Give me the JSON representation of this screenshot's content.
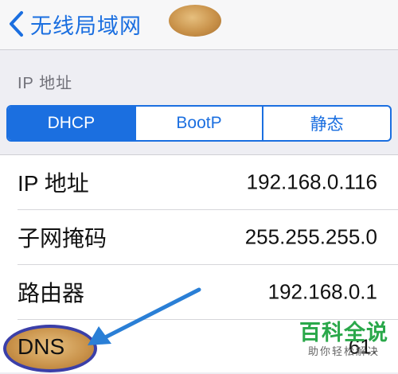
{
  "navbar": {
    "back_label": "无线局域网"
  },
  "section": {
    "header": "IP 地址"
  },
  "segmented": {
    "options": [
      "DHCP",
      "BootP",
      "静态"
    ],
    "selected": "DHCP"
  },
  "rows": [
    {
      "label": "IP 地址",
      "value": "192.168.0.116"
    },
    {
      "label": "子网掩码",
      "value": "255.255.255.0"
    },
    {
      "label": "路由器",
      "value": "192.168.0.1"
    },
    {
      "label": "DNS",
      "value": "61."
    }
  ],
  "watermark": {
    "title": "百科全说",
    "subtitle": "助你轻松解决"
  },
  "colors": {
    "accent": "#1b6fe0",
    "annotation": "#3b3fa8",
    "watermark": "#2aa84a"
  }
}
